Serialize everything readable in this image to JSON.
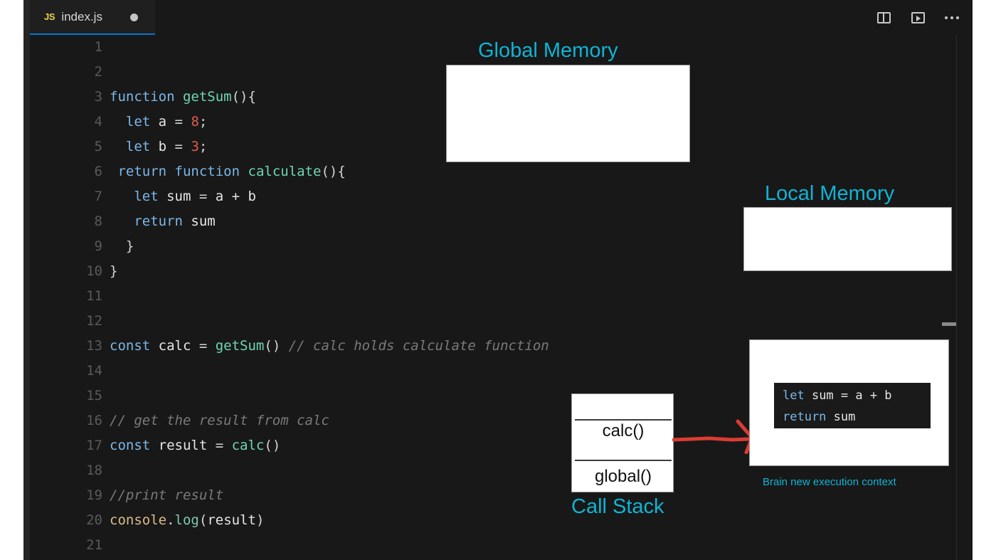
{
  "window": {
    "app": "code-editor",
    "tab": {
      "icon": "js-file-icon",
      "label": "index.js",
      "dirty_indicator": "●"
    },
    "toolbar": {
      "split_editor": "split-editor-icon",
      "run_file": "run-play-icon",
      "more_actions": "ellipsis-icon"
    }
  },
  "editor": {
    "language": "javascript",
    "lines": [
      {
        "number": "1",
        "tokens": []
      },
      {
        "number": "2",
        "tokens": []
      },
      {
        "number": "3",
        "tokens": [
          {
            "t": "kw",
            "s": "function"
          },
          {
            "t": "punc",
            "s": " "
          },
          {
            "t": "fn",
            "s": "getSum"
          },
          {
            "t": "punc",
            "s": "(){"
          }
        ]
      },
      {
        "number": "4",
        "tokens": [
          {
            "t": "punc",
            "s": "  "
          },
          {
            "t": "kw",
            "s": "let"
          },
          {
            "t": "var",
            "s": " a "
          },
          {
            "t": "punc",
            "s": "= "
          },
          {
            "t": "num",
            "s": "8"
          },
          {
            "t": "punc",
            "s": ";"
          }
        ]
      },
      {
        "number": "5",
        "tokens": [
          {
            "t": "punc",
            "s": "  "
          },
          {
            "t": "kw",
            "s": "let"
          },
          {
            "t": "var",
            "s": " b "
          },
          {
            "t": "punc",
            "s": "= "
          },
          {
            "t": "num",
            "s": "3"
          },
          {
            "t": "punc",
            "s": ";"
          }
        ]
      },
      {
        "number": "6",
        "tokens": [
          {
            "t": "punc",
            "s": " "
          },
          {
            "t": "kw",
            "s": "return function"
          },
          {
            "t": "punc",
            "s": " "
          },
          {
            "t": "fn",
            "s": "calculate"
          },
          {
            "t": "punc",
            "s": "(){"
          }
        ]
      },
      {
        "number": "7",
        "tokens": [
          {
            "t": "punc",
            "s": "   "
          },
          {
            "t": "kw",
            "s": "let"
          },
          {
            "t": "var",
            "s": " sum "
          },
          {
            "t": "punc",
            "s": "= "
          },
          {
            "t": "var",
            "s": "a + b"
          }
        ]
      },
      {
        "number": "8",
        "tokens": [
          {
            "t": "punc",
            "s": "   "
          },
          {
            "t": "kw",
            "s": "return"
          },
          {
            "t": "var",
            "s": " sum"
          }
        ]
      },
      {
        "number": "9",
        "tokens": [
          {
            "t": "punc",
            "s": "  }"
          }
        ]
      },
      {
        "number": "10",
        "tokens": [
          {
            "t": "punc",
            "s": "}"
          }
        ]
      },
      {
        "number": "11",
        "tokens": []
      },
      {
        "number": "12",
        "tokens": []
      },
      {
        "number": "13",
        "tokens": [
          {
            "t": "kw",
            "s": "const"
          },
          {
            "t": "var",
            "s": " calc "
          },
          {
            "t": "punc",
            "s": "= "
          },
          {
            "t": "fn",
            "s": "getSum"
          },
          {
            "t": "punc",
            "s": "() "
          },
          {
            "t": "cmt",
            "s": "// calc holds calculate function"
          }
        ]
      },
      {
        "number": "14",
        "tokens": []
      },
      {
        "number": "15",
        "tokens": []
      },
      {
        "number": "16",
        "tokens": [
          {
            "t": "cmt",
            "s": "// get the result from calc"
          }
        ]
      },
      {
        "number": "17",
        "tokens": [
          {
            "t": "kw",
            "s": "const"
          },
          {
            "t": "var",
            "s": " result "
          },
          {
            "t": "punc",
            "s": "= "
          },
          {
            "t": "fn",
            "s": "calc"
          },
          {
            "t": "punc",
            "s": "()"
          }
        ]
      },
      {
        "number": "18",
        "tokens": []
      },
      {
        "number": "19",
        "tokens": [
          {
            "t": "cmt",
            "s": "//print result"
          }
        ]
      },
      {
        "number": "20",
        "tokens": [
          {
            "t": "obj",
            "s": "console"
          },
          {
            "t": "punc",
            "s": "."
          },
          {
            "t": "meth",
            "s": "log"
          },
          {
            "t": "punc",
            "s": "("
          },
          {
            "t": "var",
            "s": "result"
          },
          {
            "t": "punc",
            "s": ")"
          }
        ]
      },
      {
        "number": "21",
        "tokens": []
      }
    ]
  },
  "annotations": {
    "accent_color": "#0fb4d4",
    "arrow_color": "#dc3c32",
    "global_memory": {
      "label": "Global Memory",
      "contents": ""
    },
    "local_memory": {
      "label": "Local Memory",
      "contents": ""
    },
    "call_stack": {
      "label": "Call Stack",
      "frames": [
        "calc()",
        "global()"
      ]
    },
    "execution_context": {
      "caption": "Brain new execution context",
      "code": [
        {
          "kw": "let",
          "rest": " sum = a + b"
        },
        {
          "kw": "return",
          "rest": " sum"
        }
      ]
    }
  }
}
